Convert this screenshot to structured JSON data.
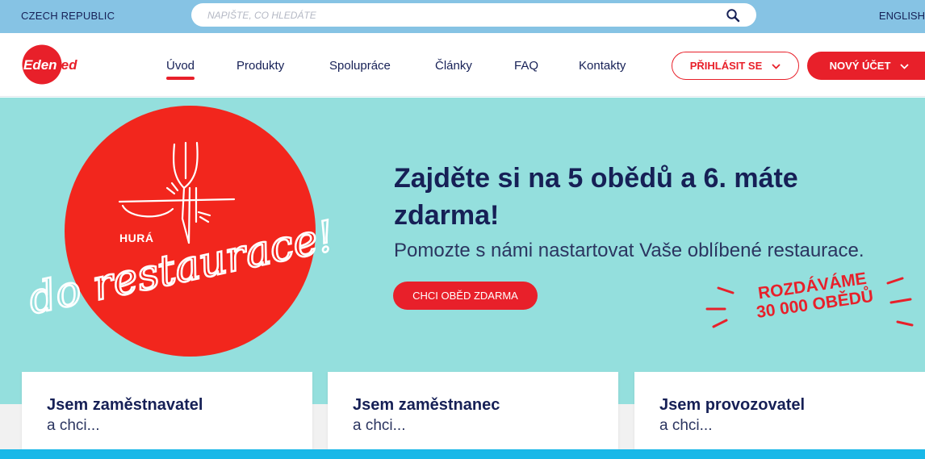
{
  "topbar": {
    "country": "CZECH REPUBLIC",
    "search_placeholder": "NAPIŠTE, CO HLEDÁTE",
    "search_value": "",
    "language": "ENGLISH"
  },
  "brand": {
    "logo_text": "Edenred",
    "color_primary": "#e8202a",
    "color_navy": "#162056",
    "color_hero": "#94dfdd",
    "color_topbar": "#86c3e4"
  },
  "nav": {
    "items": [
      {
        "label": "Úvod",
        "active": true
      },
      {
        "label": "Produkty",
        "active": false
      },
      {
        "label": "Spolupráce",
        "active": false
      },
      {
        "label": "Články",
        "active": false
      },
      {
        "label": "FAQ",
        "active": false
      },
      {
        "label": "Kontakty",
        "active": false
      }
    ],
    "login_label": "PŘIHLÁSIT SE",
    "new_account_label": "NOVÝ ÚČET"
  },
  "hero": {
    "hura": "HURÁ",
    "script_text": "do restaurace!",
    "title": "Zajděte si na 5 obědů a 6. máte zdarma!",
    "subtitle": "Pomozte s námi nastartovat Vaše oblíbené restaurace.",
    "cta_label": "CHCI OBĚD ZDARMA",
    "badge_line1": "ROZDÁVÁME",
    "badge_line2": "30 000 OBĚDŮ"
  },
  "cards": [
    {
      "title": "Jsem zaměstnavatel",
      "subtitle": "a chci..."
    },
    {
      "title": "Jsem zaměstnanec",
      "subtitle": "a chci..."
    },
    {
      "title": "Jsem provozovatel",
      "subtitle": "a chci..."
    }
  ],
  "icons": {
    "search": "search-icon",
    "chevron": "chevron-down-icon",
    "fork": "fork-icon",
    "plate": "plate-icon"
  }
}
